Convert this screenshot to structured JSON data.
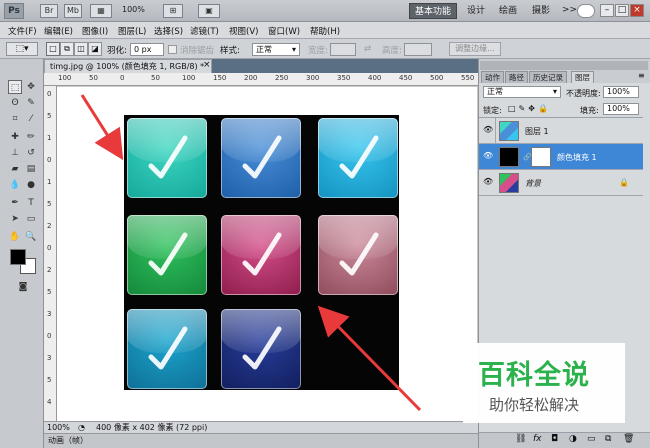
{
  "app": {
    "logo": "Ps",
    "title_icons": [
      "Br",
      "Mb"
    ],
    "zoom": "100%",
    "workspaces": [
      "基本功能",
      "设计",
      "绘画",
      "摄影"
    ],
    "more_glyph": ">>",
    "window_controls": [
      "–",
      "□",
      "×"
    ]
  },
  "menu": [
    "文件(F)",
    "编辑(E)",
    "图像(I)",
    "图层(L)",
    "选择(S)",
    "滤镜(T)",
    "视图(V)",
    "窗口(W)",
    "帮助(H)"
  ],
  "options": {
    "feather_label": "羽化:",
    "feather_value": "0 px",
    "antialias_label": "消除锯齿",
    "style_label": "样式:",
    "style_value": "正常",
    "width_label": "宽度:",
    "height_label": "高度:",
    "refine_edge": "调整边缘..."
  },
  "document": {
    "tab_title": "timg.jpg @ 100% (颜色填充 1, RGB/8) *",
    "close": "×",
    "ruler_h": [
      "100",
      "50",
      "0",
      "50",
      "100",
      "150",
      "200",
      "250",
      "300",
      "350",
      "400",
      "450",
      "500",
      "550"
    ],
    "ruler_v": [
      "0",
      "5",
      "1",
      "0",
      "1",
      "5",
      "2",
      "0",
      "2",
      "5",
      "3",
      "0",
      "3",
      "5",
      "4"
    ],
    "status_zoom": "100%",
    "status_info": "400 像素 x 402 像素 (72 ppi)",
    "anim_tab": "动画（帧）"
  },
  "panels": {
    "tabs": [
      "动作",
      "路径",
      "历史记录",
      "图层"
    ],
    "active_tab": "图层",
    "blend_mode": "正常",
    "opacity_label": "不透明度:",
    "opacity_value": "100%",
    "lock_label": "锁定:",
    "fill_label": "填充:",
    "fill_value": "100%",
    "layers": [
      {
        "name": "图层 1",
        "selected": false
      },
      {
        "name": "颜色填充 1",
        "selected": true
      },
      {
        "name": "背景",
        "selected": false,
        "locked": true
      }
    ],
    "bottom_icons": [
      "link-icon",
      "fx-icon",
      "mask-icon",
      "adjustment-icon",
      "folder-icon",
      "new-layer-icon",
      "trash-icon"
    ]
  },
  "artwork": {
    "tiles": [
      {
        "color": "#3fd7c2",
        "dark": "#14a89a"
      },
      {
        "color": "#4a8fd8",
        "dark": "#1e5ea8"
      },
      {
        "color": "#37c6ee",
        "dark": "#1592c0"
      },
      {
        "color": "#2fc35e",
        "dark": "#15883b"
      },
      {
        "color": "#d54f8a",
        "dark": "#8e1d4c"
      },
      {
        "color": "#cc8b9c",
        "dark": "#8e4b5c"
      },
      {
        "color": "#1ca7cf",
        "dark": "#0f6f96"
      },
      {
        "color": "#283e9c",
        "dark": "#121f5e"
      },
      null
    ]
  },
  "watermark": {
    "title": "百科全说",
    "subtitle": "助你轻松解决"
  },
  "colors": {
    "accent_green": "#2bb24c",
    "arrow_red": "#e83a3a",
    "selected_layer": "#3e86d6"
  }
}
